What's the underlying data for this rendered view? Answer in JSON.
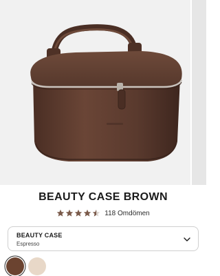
{
  "product": {
    "title": "BEAUTY CASE BROWN",
    "rating_value": 4.5,
    "rating_max": 5,
    "reviews_text": "118 Omdömen",
    "image_icon": "toiletry-bag-image"
  },
  "variant": {
    "name": "BEAUTY CASE",
    "color": "Espresso",
    "chevron_icon": "chevron-down-icon"
  },
  "swatches": [
    {
      "name": "Espresso",
      "color": "#6b4330",
      "selected": true
    },
    {
      "name": "Beige",
      "color": "#e8d8c8",
      "selected": false
    }
  ],
  "colors": {
    "star": "#7a5a4a",
    "bag": "#5a3a2e"
  }
}
